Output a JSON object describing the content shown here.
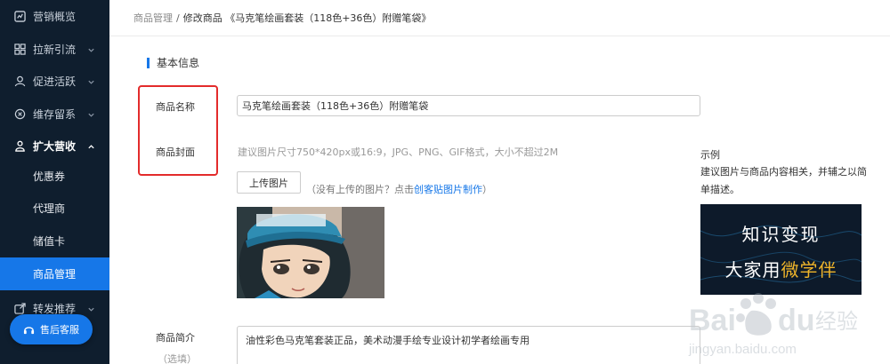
{
  "sidebar": {
    "items": [
      {
        "label": "营销概览",
        "icon": "chart-icon"
      },
      {
        "label": "拉新引流",
        "icon": "funnel-icon"
      },
      {
        "label": "促进活跃",
        "icon": "user-icon"
      },
      {
        "label": "维存留系",
        "icon": "retention-icon"
      },
      {
        "label": "扩大营收",
        "icon": "wallet-icon"
      }
    ],
    "sub_items": [
      {
        "label": "优惠券"
      },
      {
        "label": "代理商"
      },
      {
        "label": "储值卡"
      },
      {
        "label": "商品管理"
      }
    ],
    "bottom_item": {
      "label": "转发推荐",
      "icon": "share-icon"
    },
    "service_button": {
      "label": "售后客服",
      "icon": "headset-icon"
    }
  },
  "breadcrumb": {
    "parent": "商品管理",
    "separator": "/",
    "current": "修改商品 《马克笔绘画套装（118色+36色）附赠笔袋》"
  },
  "section_title": "基本信息",
  "form": {
    "name_label": "商品名称",
    "name_value": "马克笔绘画套装（118色+36色）附赠笔袋",
    "cover_label": "商品封面",
    "cover_hint": "建议图片尺寸750*420px或16:9，JPG、PNG、GIF格式，大小不超过2M",
    "upload_button": "上传图片",
    "upload_note_prefix": "（没有上传的图片？点击",
    "upload_note_link": "创客贴图片制作",
    "upload_note_suffix": "）",
    "intro_label": "商品简介",
    "intro_hint": "（选填）",
    "intro_value": "油性彩色马克笔套装正品，美术动漫手绘专业设计初学者绘画专用"
  },
  "example": {
    "title": "示例",
    "desc": "建议图片与商品内容相关，并辅之以简单描述。",
    "line1": "知识变现",
    "line2_prefix": "大家用",
    "line2_accent": "微学伴"
  },
  "colors": {
    "sidebar_bg": "#0f1e2e",
    "accent": "#1677e8",
    "highlight_box": "#e32b2b"
  }
}
